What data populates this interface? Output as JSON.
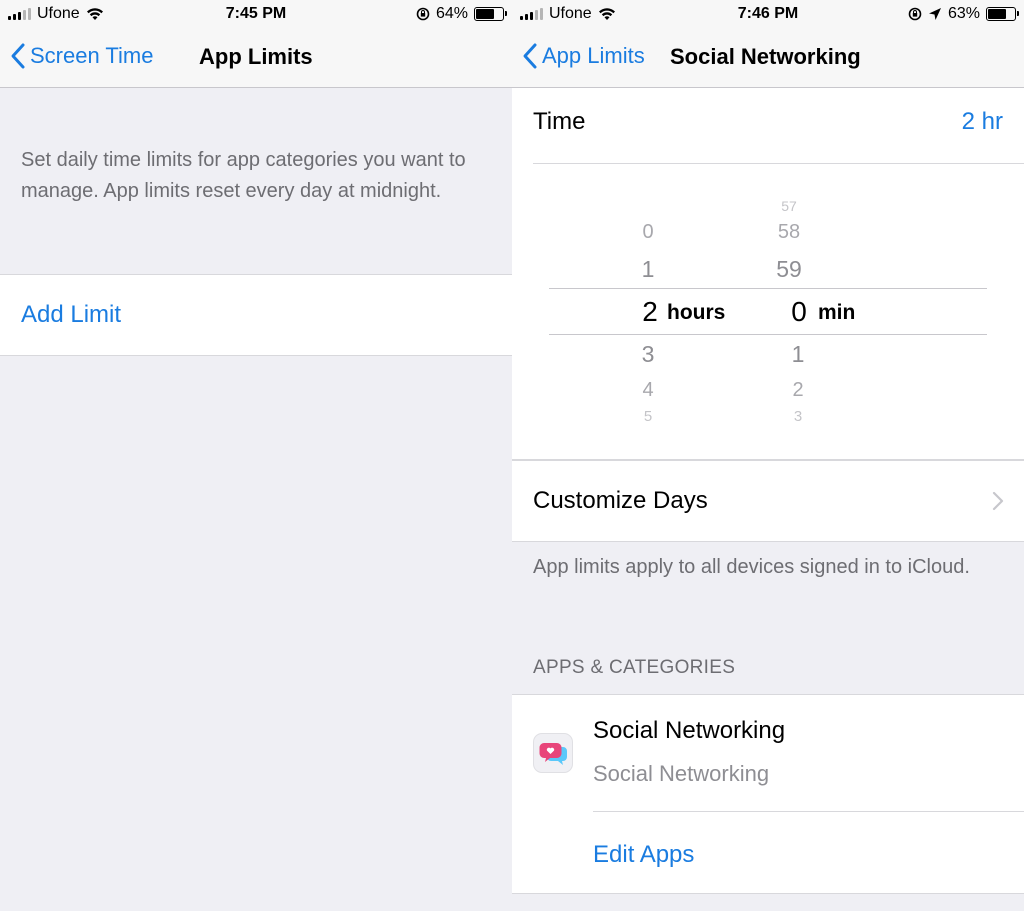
{
  "left": {
    "status": {
      "carrier": "Ufone",
      "time": "7:45 PM",
      "battery": "64%",
      "battery_level": 0.64
    },
    "nav": {
      "back_label": "Screen Time",
      "title": "App Limits"
    },
    "description": "Set daily time limits for app categories you want to manage. App limits reset every day at midnight.",
    "add_limit_label": "Add Limit"
  },
  "right": {
    "status": {
      "carrier": "Ufone",
      "time": "7:46 PM",
      "battery": "63%",
      "battery_level": 0.63
    },
    "nav": {
      "back_label": "App Limits",
      "title": "Social Networking"
    },
    "time": {
      "label": "Time",
      "value": "2 hr"
    },
    "picker": {
      "hours_above": [
        "0",
        "1"
      ],
      "hours_selected": "2",
      "hours_unit": "hours",
      "hours_below": [
        "3",
        "4",
        "5"
      ],
      "minutes_above": [
        "57",
        "58",
        "59"
      ],
      "minutes_selected": "0",
      "minutes_unit": "min",
      "minutes_below": [
        "1",
        "2",
        "3"
      ]
    },
    "customize_days_label": "Customize Days",
    "note": "App limits apply to all devices signed in to iCloud.",
    "section_header": "APPS & CATEGORIES",
    "app": {
      "title": "Social Networking",
      "subtitle": "Social Networking",
      "icon": "social-networking-icon"
    },
    "edit_apps_label": "Edit Apps"
  },
  "colors": {
    "accent": "#1a7ce0",
    "background": "#efeff4",
    "secondary_text": "#6d6d72"
  }
}
